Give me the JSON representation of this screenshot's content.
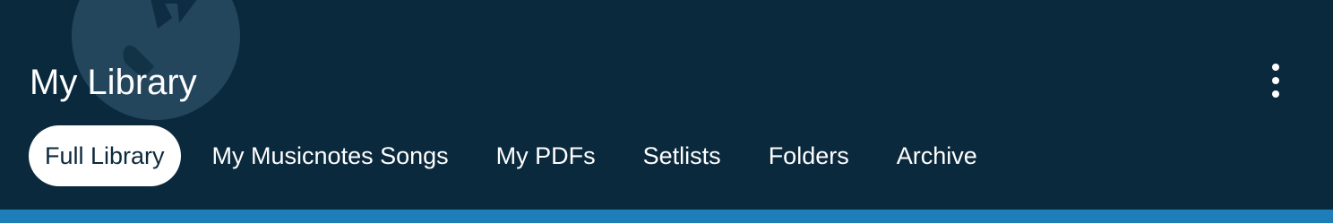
{
  "header": {
    "title": "My Library",
    "more_icon": "more-vertical-icon",
    "logo_icon": "musicnotes-logo-icon"
  },
  "tabs": [
    {
      "label": "Full Library",
      "active": true
    },
    {
      "label": "My Musicnotes Songs",
      "active": false
    },
    {
      "label": "My PDFs",
      "active": false
    },
    {
      "label": "Setlists",
      "active": false
    },
    {
      "label": "Folders",
      "active": false
    },
    {
      "label": "Archive",
      "active": false
    }
  ],
  "colors": {
    "header_bg": "#0b293d",
    "accent_bar": "#1d7eb9",
    "active_tab_bg": "#ffffff",
    "text": "#ffffff"
  }
}
